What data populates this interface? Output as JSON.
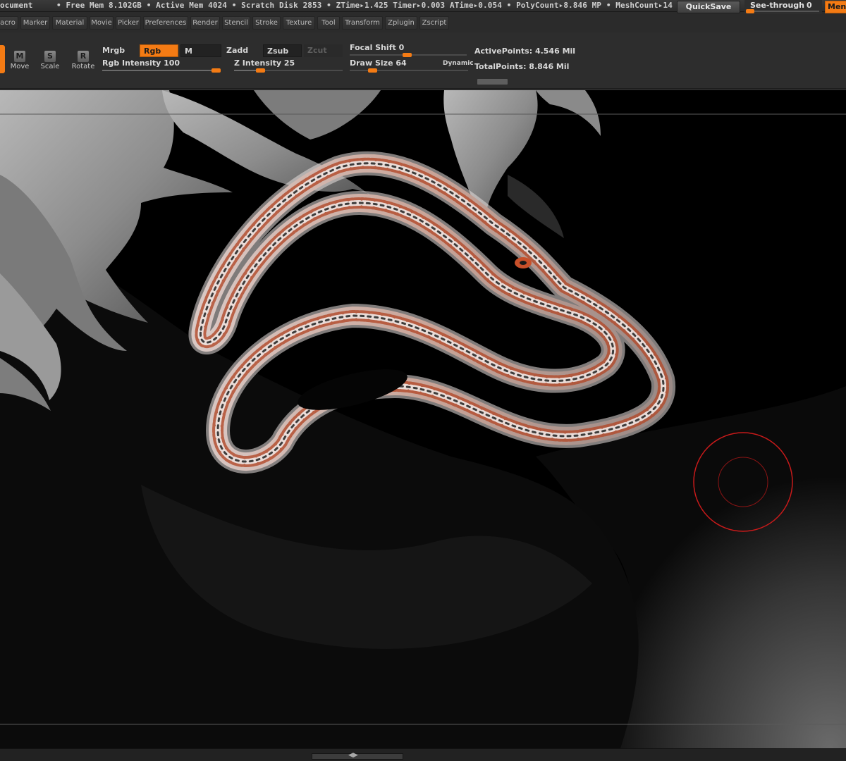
{
  "status": {
    "document": "ocument",
    "stats": "• Free Mem 8.102GB • Active Mem 4024 • Scratch Disk 2853 • ZTime▸1.425 Timer▸0.003 ATime▸0.054 • PolyCount▸8.846 MP • MeshCount▸14",
    "quicksave": "QuickSave",
    "seethrough_label": "See-through",
    "seethrough_value": "0",
    "menus_label": "Menu"
  },
  "menu": {
    "items": [
      "acro",
      "Marker",
      "Material",
      "Movie",
      "Picker",
      "Preferences",
      "Render",
      "Stencil",
      "Stroke",
      "Texture",
      "Tool",
      "Transform",
      "Zplugin",
      "Zscript"
    ]
  },
  "shelf": {
    "tools": [
      {
        "glyph": "M",
        "label": "Move"
      },
      {
        "glyph": "S",
        "label": "Scale"
      },
      {
        "glyph": "R",
        "label": "Rotate"
      }
    ],
    "mrgb": "Mrgb",
    "rgb": "Rgb",
    "m": "M",
    "zadd": "Zadd",
    "zsub": "Zsub",
    "zcut": "Zcut",
    "rgb_intensity_label": "Rgb Intensity",
    "rgb_intensity_value": "100",
    "z_intensity_label": "Z Intensity",
    "z_intensity_value": "25",
    "focal_shift_label": "Focal Shift",
    "focal_shift_value": "0",
    "draw_size_label": "Draw Size",
    "draw_size_value": "64",
    "dynamic": "Dynamic",
    "active_points": "ActivePoints: 4.546 Mil",
    "total_points": "TotalPoints: 8.846 Mil"
  },
  "slider_levels": {
    "rgb_intensity": 1.0,
    "z_intensity": 0.25,
    "focal_shift": 0.5,
    "draw_size": 0.2,
    "see_through": 0
  },
  "colors": {
    "accent": "#f47b14",
    "brush_cursor": "#c81a1a"
  }
}
